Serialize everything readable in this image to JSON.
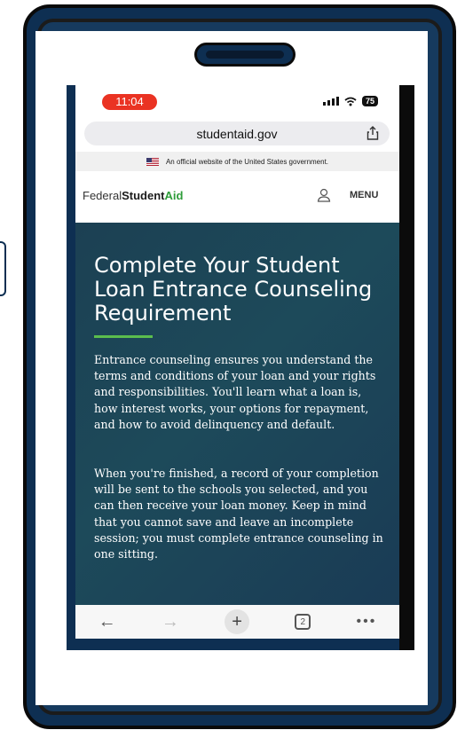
{
  "status": {
    "time": "11:04",
    "battery": "75"
  },
  "browser": {
    "url": "studentaid.gov",
    "tab_count": "2"
  },
  "gov_banner": {
    "text": "An official website of the United States government."
  },
  "site": {
    "logo_federal": "Federal",
    "logo_student": "Student",
    "logo_aid": "Aid",
    "menu_label": "MENU"
  },
  "hero": {
    "title": "Complete Your Student Loan Entrance Counseling Requirement",
    "paragraph1": "Entrance counseling ensures you understand the terms and conditions of your loan and your rights and responsibilities. You'll learn what a loan is, how interest works, your options for repayment, and how to avoid delinquency and default.",
    "paragraph2": "When you're finished, a record of your completion will be sent to the schools you selected, and you can then receive your loan money. Keep in mind that you cannot save and leave an incomplete session; you must complete entrance counseling in one sitting."
  },
  "colors": {
    "frame": "#0e2f52",
    "hero_bg": "#1c4053",
    "accent_green": "#5bbd4d",
    "time_pill": "#ea3323"
  },
  "icons": [
    "back-arrow-icon",
    "forward-arrow-icon",
    "plus-icon",
    "tabs-icon",
    "more-icon",
    "share-icon",
    "user-icon",
    "owl-chat-icon",
    "wifi-icon",
    "signal-icon"
  ]
}
